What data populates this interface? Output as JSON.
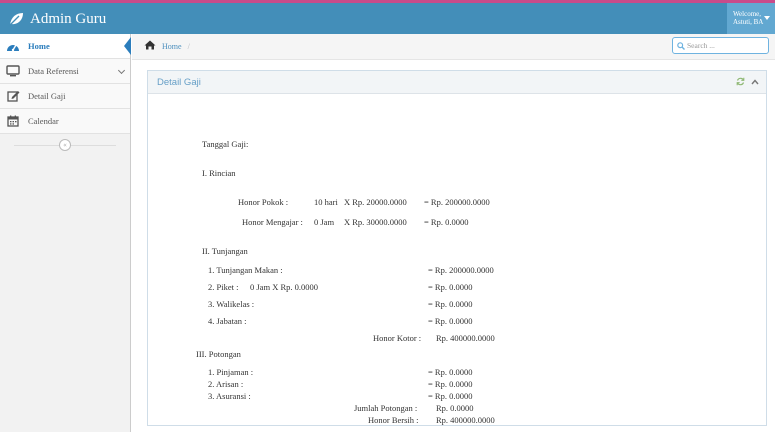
{
  "navbar": {
    "brand": "Admin Guru",
    "user_line1": "Welcome,",
    "user_line2": "Astuti, BA"
  },
  "sidebar": {
    "items": [
      {
        "label": "Home",
        "icon": "tachometer-icon"
      },
      {
        "label": "Data Referensi",
        "icon": "monitor-icon"
      },
      {
        "label": "Detail Gaji",
        "icon": "edit-icon"
      },
      {
        "label": "Calendar",
        "icon": "calendar-icon"
      }
    ]
  },
  "breadcrumb": {
    "home": "Home",
    "separator": "/"
  },
  "search": {
    "placeholder": "Search ..."
  },
  "widget": {
    "title": "Detail Gaji"
  },
  "detail": {
    "tanggal": "Tanggal Gaji:",
    "section1": "I. Rincian",
    "honor_pokok": {
      "label": "Honor Pokok :",
      "qty": "10 hari",
      "rate": "X Rp. 20000.0000",
      "total": "= Rp. 200000.0000"
    },
    "honor_mengajar": {
      "label": "Honor Mengajar :",
      "qty": "0 Jam",
      "rate": "X Rp. 30000.0000",
      "total": "= Rp. 0.0000"
    },
    "section2": "II. Tunjangan",
    "tunjangan": [
      {
        "label": "1. Tunjangan Makan :",
        "extra": "",
        "total": "= Rp. 200000.0000"
      },
      {
        "label": "2. Piket :",
        "extra": "0 Jam   X Rp. 0.0000",
        "total": "= Rp. 0.0000"
      },
      {
        "label": "3. Walikelas :",
        "extra": "",
        "total": "= Rp. 0.0000"
      },
      {
        "label": "4. Jabatan :",
        "extra": "",
        "total": "= Rp.  0.0000"
      }
    ],
    "honor_kotor": {
      "label": "Honor Kotor :",
      "value": "Rp.  400000.0000"
    },
    "section3": "III. Potongan",
    "potongan": [
      {
        "label": "1. Pinjaman :",
        "total": "= Rp.  0.0000"
      },
      {
        "label": "2. Arisan :",
        "total": "= Rp.  0.0000"
      },
      {
        "label": "3. Asuransi :",
        "total": "= Rp.  0.0000"
      }
    ],
    "jumlah_potongan": {
      "label": "Jumlah Potongan :",
      "value": "Rp.  0.0000"
    },
    "honor_bersih": {
      "label": "Honor Bersih :",
      "value": "Rp.  400000.0000"
    }
  },
  "colors": {
    "navbar": "#438eb9",
    "accent_line": "#c94b8a",
    "active": "#2b7dbc"
  }
}
